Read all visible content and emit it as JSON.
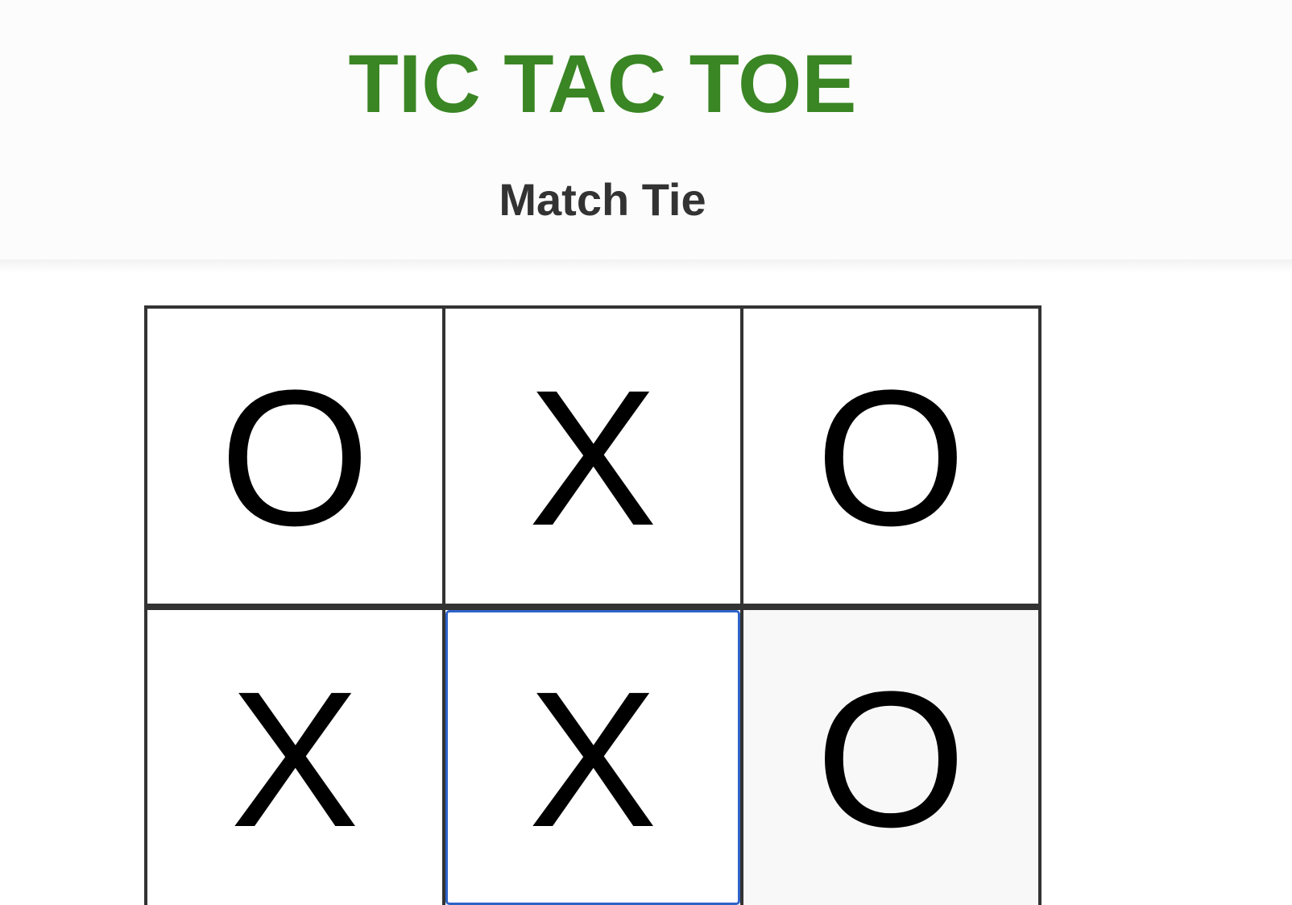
{
  "header": {
    "title": "TIC TAC TOE",
    "status": "Match Tie"
  },
  "board": {
    "cells": [
      {
        "row": 1,
        "col": 1,
        "mark": "O"
      },
      {
        "row": 1,
        "col": 2,
        "mark": "X"
      },
      {
        "row": 1,
        "col": 3,
        "mark": "O"
      },
      {
        "row": 2,
        "col": 1,
        "mark": "X"
      },
      {
        "row": 2,
        "col": 2,
        "mark": "X"
      },
      {
        "row": 2,
        "col": 3,
        "mark": "O"
      }
    ]
  },
  "colors": {
    "title": "#3a8524",
    "status": "#333333",
    "grid_border": "#333333",
    "focus_ring": "#2e63c8",
    "hover_cell": "#f8f8f8"
  }
}
